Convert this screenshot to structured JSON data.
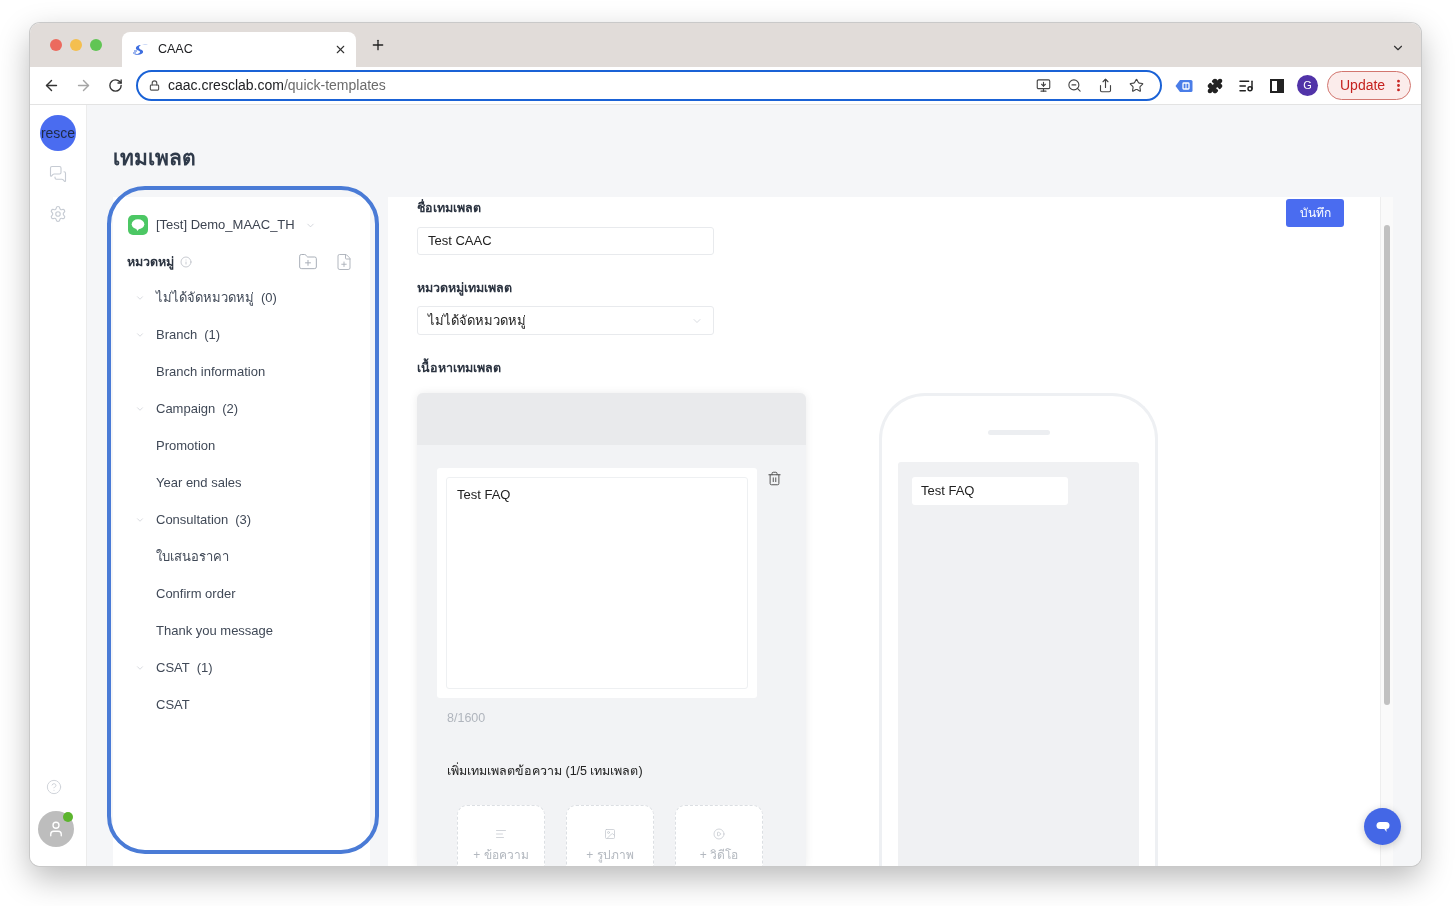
{
  "browser": {
    "tabs": [
      {
        "title": "CAAC",
        "selected": true
      }
    ],
    "url_host": "caac.cresclab.com",
    "url_path": "/quick-templates",
    "profile_initial": "G",
    "update_button": "Update"
  },
  "nav_rail": {
    "logo_text": "resce",
    "user_online": true
  },
  "page": {
    "title": "เทมเพลต"
  },
  "category_panel": {
    "account": "[Test] Demo_MAAC_TH",
    "heading": "หมวดหมู่",
    "tree": [
      {
        "label": "ไม่ได้จัดหมวดหมู่",
        "count": "(0)",
        "expanded": true
      },
      {
        "label": "Branch",
        "count": "(1)",
        "expanded": true,
        "children": [
          {
            "label": "Branch information"
          }
        ]
      },
      {
        "label": "Campaign",
        "count": "(2)",
        "expanded": true,
        "children": [
          {
            "label": "Promotion"
          },
          {
            "label": "Year end sales"
          }
        ]
      },
      {
        "label": "Consultation",
        "count": "(3)",
        "expanded": true,
        "children": [
          {
            "label": "ใบเสนอราคา"
          },
          {
            "label": "Confirm order"
          },
          {
            "label": "Thank you message"
          }
        ]
      },
      {
        "label": "CSAT",
        "count": "(1)",
        "expanded": true,
        "children": [
          {
            "label": "CSAT"
          }
        ]
      }
    ]
  },
  "template_form": {
    "name_label": "ชื่อเทมเพลต",
    "name_value": "Test CAAC",
    "save_button": "บันทึก",
    "category_label": "หมวดหมู่เทมเพลต",
    "category_value": "ไม่ได้จัดหมวดหมู่",
    "content_label": "เนื้อหาเทมเพลต"
  },
  "editor": {
    "message_text": "Test FAQ",
    "char_count": "8/1600",
    "add_heading": "เพิ่มเทมเพลตข้อความ (1/5 เทมเพลต)",
    "add_options": [
      {
        "kind": "text",
        "label": "+ ข้อความ"
      },
      {
        "kind": "image",
        "label": "+ รูปภาพ"
      },
      {
        "kind": "video",
        "label": "+ วิดีโอ"
      }
    ]
  },
  "preview": {
    "messages": [
      "Test FAQ"
    ]
  }
}
